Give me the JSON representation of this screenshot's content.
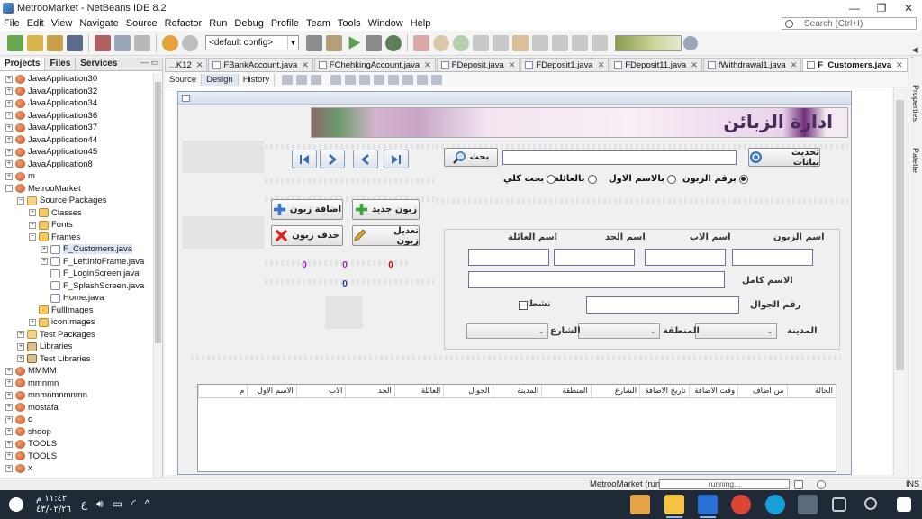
{
  "window": {
    "title": "MetrooMarket - NetBeans IDE 8.2",
    "minimize": "—",
    "maximize": "❐",
    "close": "✕"
  },
  "menu": [
    "File",
    "Edit",
    "View",
    "Navigate",
    "Source",
    "Refactor",
    "Run",
    "Debug",
    "Profile",
    "Team",
    "Tools",
    "Window",
    "Help"
  ],
  "search": {
    "placeholder": "Search (Ctrl+I)"
  },
  "toolbar": {
    "config": "<default config>"
  },
  "projects_panel": {
    "tabs": [
      "Projects",
      "Files",
      "Services"
    ],
    "tree": [
      {
        "label": "JavaApplication30",
        "indent": 0,
        "icon": "proj",
        "exp": "+"
      },
      {
        "label": "JavaApplication32",
        "indent": 0,
        "icon": "proj",
        "exp": "+"
      },
      {
        "label": "JavaApplication34",
        "indent": 0,
        "icon": "proj",
        "exp": "+"
      },
      {
        "label": "JavaApplication36",
        "indent": 0,
        "icon": "proj",
        "exp": "+"
      },
      {
        "label": "JavaApplication37",
        "indent": 0,
        "icon": "proj",
        "exp": "+"
      },
      {
        "label": "JavaApplication44",
        "indent": 0,
        "icon": "proj",
        "exp": "+"
      },
      {
        "label": "JavaApplication45",
        "indent": 0,
        "icon": "proj",
        "exp": "+"
      },
      {
        "label": "JavaApplication8",
        "indent": 0,
        "icon": "proj",
        "exp": "+"
      },
      {
        "label": "m",
        "indent": 0,
        "icon": "proj",
        "exp": "+"
      },
      {
        "label": "MetrooMarket",
        "indent": 0,
        "icon": "proj",
        "exp": "−"
      },
      {
        "label": "Source Packages",
        "indent": 1,
        "icon": "folder",
        "exp": "−"
      },
      {
        "label": "Classes",
        "indent": 2,
        "icon": "pkg",
        "exp": "+"
      },
      {
        "label": "Fonts",
        "indent": 2,
        "icon": "pkg",
        "exp": "+"
      },
      {
        "label": "Frames",
        "indent": 2,
        "icon": "pkg",
        "exp": "−"
      },
      {
        "label": "F_Customers.java",
        "indent": 3,
        "icon": "file",
        "exp": "+",
        "selected": true
      },
      {
        "label": "F_LeftInfoFrame.java",
        "indent": 3,
        "icon": "file",
        "exp": "+"
      },
      {
        "label": "F_LoginScreen.java",
        "indent": 3,
        "icon": "file",
        "exp": ""
      },
      {
        "label": "F_SplashScreen.java",
        "indent": 3,
        "icon": "file",
        "exp": ""
      },
      {
        "label": "Home.java",
        "indent": 3,
        "icon": "file",
        "exp": ""
      },
      {
        "label": "FullImages",
        "indent": 2,
        "icon": "pkg",
        "exp": ""
      },
      {
        "label": "iconImages",
        "indent": 2,
        "icon": "pkg",
        "exp": "+"
      },
      {
        "label": "Test Packages",
        "indent": 1,
        "icon": "folder",
        "exp": "+"
      },
      {
        "label": "Libraries",
        "indent": 1,
        "icon": "lib",
        "exp": "+"
      },
      {
        "label": "Test Libraries",
        "indent": 1,
        "icon": "lib",
        "exp": "+"
      },
      {
        "label": "MMMM",
        "indent": 0,
        "icon": "proj",
        "exp": "+"
      },
      {
        "label": "mmnmn",
        "indent": 0,
        "icon": "proj",
        "exp": "+"
      },
      {
        "label": "mnmnmnmnmn",
        "indent": 0,
        "icon": "proj",
        "exp": "+"
      },
      {
        "label": "mostafa",
        "indent": 0,
        "icon": "proj",
        "exp": "+"
      },
      {
        "label": "o",
        "indent": 0,
        "icon": "proj",
        "exp": "+"
      },
      {
        "label": "shoop",
        "indent": 0,
        "icon": "proj",
        "exp": "+"
      },
      {
        "label": "TOOLS",
        "indent": 0,
        "icon": "proj",
        "exp": "+"
      },
      {
        "label": "TOOLS",
        "indent": 0,
        "icon": "proj",
        "exp": "+"
      },
      {
        "label": "x",
        "indent": 0,
        "icon": "proj",
        "exp": "+"
      }
    ]
  },
  "editor_tabs": [
    {
      "label": "...K12",
      "active": false,
      "icon": false
    },
    {
      "label": "FBankAccount.java",
      "active": false,
      "icon": true
    },
    {
      "label": "FChehkingAccount.java",
      "active": false,
      "icon": true
    },
    {
      "label": "FDeposit.java",
      "active": false,
      "icon": true
    },
    {
      "label": "FDeposit1.java",
      "active": false,
      "icon": true
    },
    {
      "label": "FDeposit11.java",
      "active": false,
      "icon": true
    },
    {
      "label": "fWithdrawal1.java",
      "active": false,
      "icon": true
    },
    {
      "label": "F_Customers.java",
      "active": true,
      "icon": true
    }
  ],
  "mode_tabs": [
    "Source",
    "Design",
    "History"
  ],
  "right_strip": [
    "Properties",
    "Palette"
  ],
  "form": {
    "banner_title": "ادارة الزبائن",
    "refresh_button": "تحديث بيانات",
    "search_button": "بحث",
    "radios": [
      {
        "label": "برقم الزبون",
        "checked": true
      },
      {
        "label": "بالاسم الاول",
        "checked": false
      },
      {
        "label": "بالعائلة",
        "checked": false
      },
      {
        "label": "بحث كلي",
        "checked": false
      }
    ],
    "buttons": {
      "new_customer": "زبون جديد",
      "add_customer": "اضافة زبون",
      "edit_customer": "تعديل زبون",
      "delete_customer": "حذف زبون"
    },
    "counters": {
      "a": "0",
      "b": "0",
      "c": "0",
      "d": "0"
    },
    "labels": {
      "customer_name": "اسم الزبون",
      "father_name": "اسم الاب",
      "grandfather_name": "اسم الجد",
      "family_name": "اسم العائلة",
      "full_name": "الاسم كامل",
      "mobile": "رقم الجوال",
      "active": "نشط",
      "city": "المدينة",
      "region": "المنطقة",
      "street": "الشارع"
    },
    "table_headers": [
      "الحالة",
      "من اضاف",
      "وقت الاضافة",
      "تاريخ الاضافة",
      "الشارع",
      "المنطقة",
      "المدينة",
      "الجوال",
      "العائلة",
      "الجد",
      "الاب",
      "الاسم الاول",
      "م"
    ]
  },
  "statusbar": {
    "process": "MetrooMarket (run)",
    "progress": "running...",
    "mode": "INS"
  },
  "taskbar": {
    "time": "١١:٤٢ م",
    "date": "٤٣/٠٢/٢٦",
    "lang": "ع"
  },
  "colors": {
    "accent": "#7f6aa0",
    "counter": "#a020c0",
    "counter_red": "#d01010",
    "counter_blue": "#1c3aa9",
    "taskbar": "#1f2a36"
  }
}
